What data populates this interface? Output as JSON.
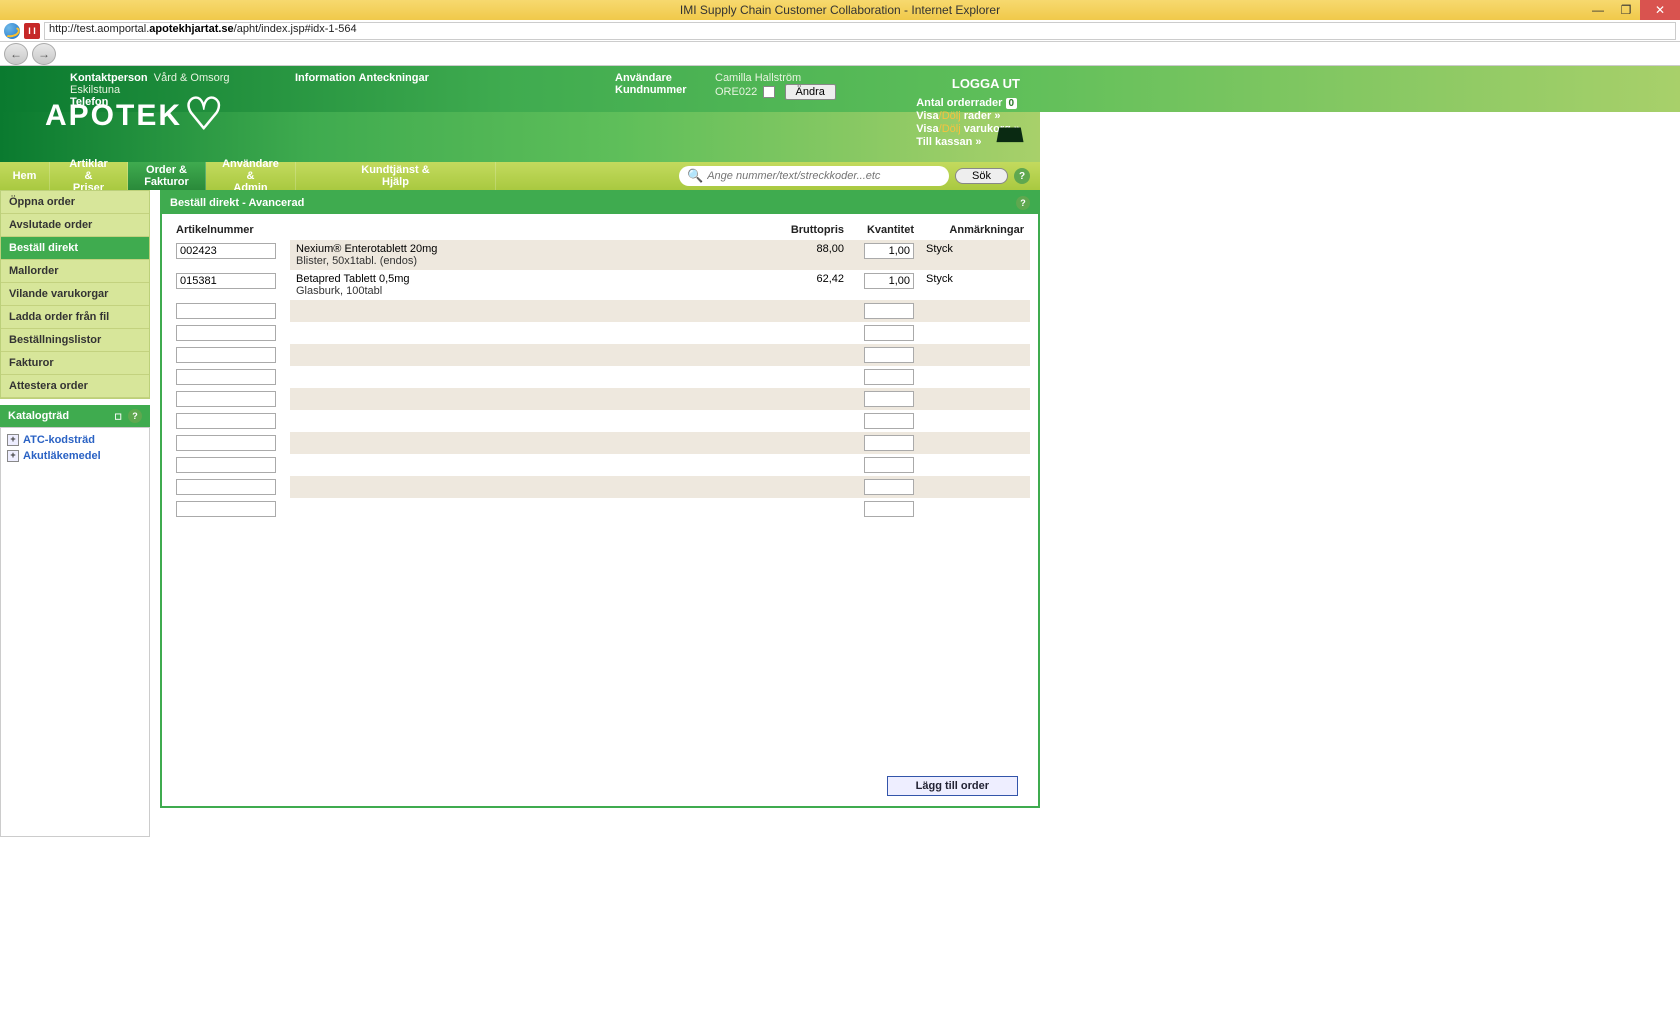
{
  "window": {
    "title": "IMI Supply Chain Customer Collaboration - Internet Explorer",
    "url_prefix": "http://test.aomportal.",
    "url_bold": "apotekhjartat.se",
    "url_suffix": "/apht/index.jsp#idx-1-564"
  },
  "header": {
    "kontakt_label": "Kontaktperson",
    "kontakt_val": "Vård & Omsorg Eskilstuna",
    "telefon_label": "Telefon",
    "info_label": "Information",
    "anteck_label": "Anteckningar",
    "anvandare_label": "Användare",
    "anvandare_val": "Camilla Hallström",
    "kundnr_label": "Kundnummer",
    "kundnr_val": "ORE022",
    "andra_btn": "Ändra",
    "logout": "LOGGA UT",
    "logo_text": "APOTEK",
    "orderrader_label": "Antal orderrader",
    "orderrader_val": "0",
    "visa": "Visa",
    "dolj": "/Dölj",
    "rader": " rader »",
    "varukorg": " varukorg »",
    "till_kassan": "Till kassan »"
  },
  "nav": {
    "t0": "Hem",
    "t1a": "Artiklar &",
    "t1b": "Priser",
    "t2a": "Order &",
    "t2b": "Fakturor",
    "t3a": "Användare &",
    "t3b": "Admin",
    "t4a": "Kundtjänst &",
    "t4b": "Hjälp",
    "search_placeholder": "Ange nummer/text/streckkoder...etc",
    "search_btn": "Sök"
  },
  "sidebar": {
    "items": [
      "Öppna order",
      "Avslutade order",
      "Beställ direkt",
      "Mallorder",
      "Vilande varukorgar",
      "Ladda order från fil",
      "Beställningslistor",
      "Fakturor",
      "Attestera order"
    ],
    "active_index": 2,
    "katalog_title": "Katalogträd",
    "tree": [
      "ATC-kodsträd",
      "Akutläkemedel"
    ]
  },
  "panel": {
    "title": "Beställ direkt - Avancerad",
    "cols": {
      "artikel": "Artikelnummer",
      "brutto": "Bruttopris",
      "kvant": "Kvantitet",
      "anm": "Anmärkningar"
    },
    "rows": [
      {
        "art": "002423",
        "desc1": "Nexium® Enterotablett 20mg",
        "desc2": "Blister, 50x1tabl. (endos)",
        "price": "88,00",
        "qty": "1,00",
        "unit": "Styck"
      },
      {
        "art": "015381",
        "desc1": "Betapred Tablett 0,5mg",
        "desc2": "Glasburk, 100tabl",
        "price": "62,42",
        "qty": "1,00",
        "unit": "Styck"
      },
      {
        "art": "",
        "desc1": "",
        "desc2": "",
        "price": "",
        "qty": "",
        "unit": ""
      },
      {
        "art": "",
        "desc1": "",
        "desc2": "",
        "price": "",
        "qty": "",
        "unit": ""
      },
      {
        "art": "",
        "desc1": "",
        "desc2": "",
        "price": "",
        "qty": "",
        "unit": ""
      },
      {
        "art": "",
        "desc1": "",
        "desc2": "",
        "price": "",
        "qty": "",
        "unit": ""
      },
      {
        "art": "",
        "desc1": "",
        "desc2": "",
        "price": "",
        "qty": "",
        "unit": ""
      },
      {
        "art": "",
        "desc1": "",
        "desc2": "",
        "price": "",
        "qty": "",
        "unit": ""
      },
      {
        "art": "",
        "desc1": "",
        "desc2": "",
        "price": "",
        "qty": "",
        "unit": ""
      },
      {
        "art": "",
        "desc1": "",
        "desc2": "",
        "price": "",
        "qty": "",
        "unit": ""
      },
      {
        "art": "",
        "desc1": "",
        "desc2": "",
        "price": "",
        "qty": "",
        "unit": ""
      },
      {
        "art": "",
        "desc1": "",
        "desc2": "",
        "price": "",
        "qty": "",
        "unit": ""
      }
    ],
    "add_btn": "Lägg till order"
  }
}
